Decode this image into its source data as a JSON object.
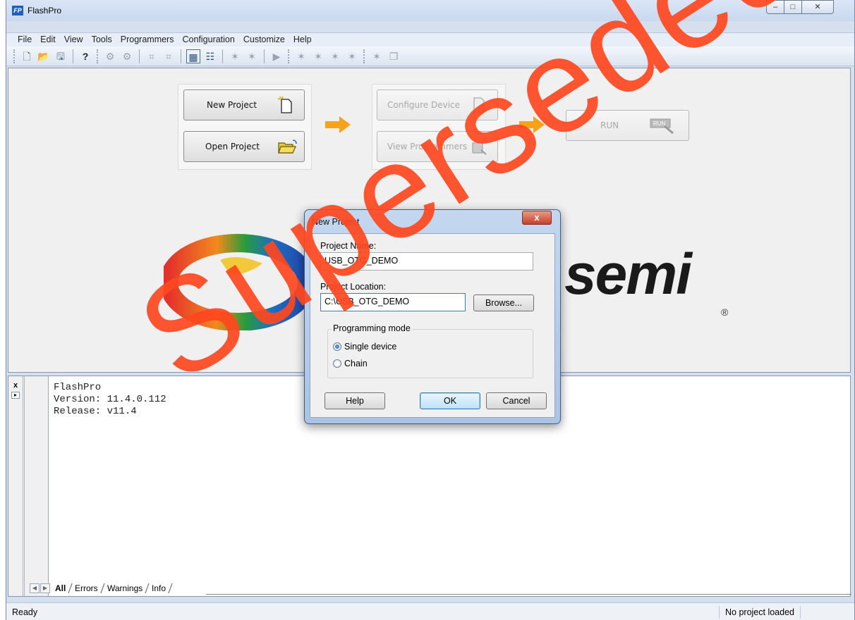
{
  "window": {
    "title": "FlashPro",
    "app_icon_text": "FP",
    "minimize_symbol": "–",
    "maximize_symbol": "□",
    "close_symbol": "✕"
  },
  "menubar": {
    "items": [
      "File",
      "Edit",
      "View",
      "Tools",
      "Programmers",
      "Configuration",
      "Customize",
      "Help"
    ]
  },
  "workflow": {
    "new_project_label": "New Project",
    "open_project_label": "Open Project",
    "configure_device_label": "Configure Device",
    "view_programmers_label": "View Programmers",
    "run_label": "RUN",
    "run_icon_text": "RUN",
    "arrow_color": "#f7a21b"
  },
  "logo": {
    "text": "semi",
    "registered": "®"
  },
  "watermark": {
    "text": "Superseded",
    "color": "#ff461e"
  },
  "dialog": {
    "title": "New Project",
    "close_symbol": "x",
    "project_name_label": "Project Name:",
    "project_name_value": "USB_OTG_DEMO",
    "project_location_label": "Project Location:",
    "project_location_value": "C:\\USB_OTG_DEMO",
    "browse_label": "Browse...",
    "programming_mode_label": "Programming mode",
    "mode_options": [
      "Single device",
      "Chain"
    ],
    "selected_mode": "Single device",
    "help_label": "Help",
    "ok_label": "OK",
    "cancel_label": "Cancel"
  },
  "log": {
    "lines": [
      "FlashPro",
      "Version: 11.4.0.112",
      "Release: v11.4"
    ],
    "tabs": [
      "All",
      "Errors",
      "Warnings",
      "Info"
    ],
    "active_tab": "All",
    "close_symbol": "x"
  },
  "statusbar": {
    "left": "Ready",
    "right": "No project loaded"
  }
}
